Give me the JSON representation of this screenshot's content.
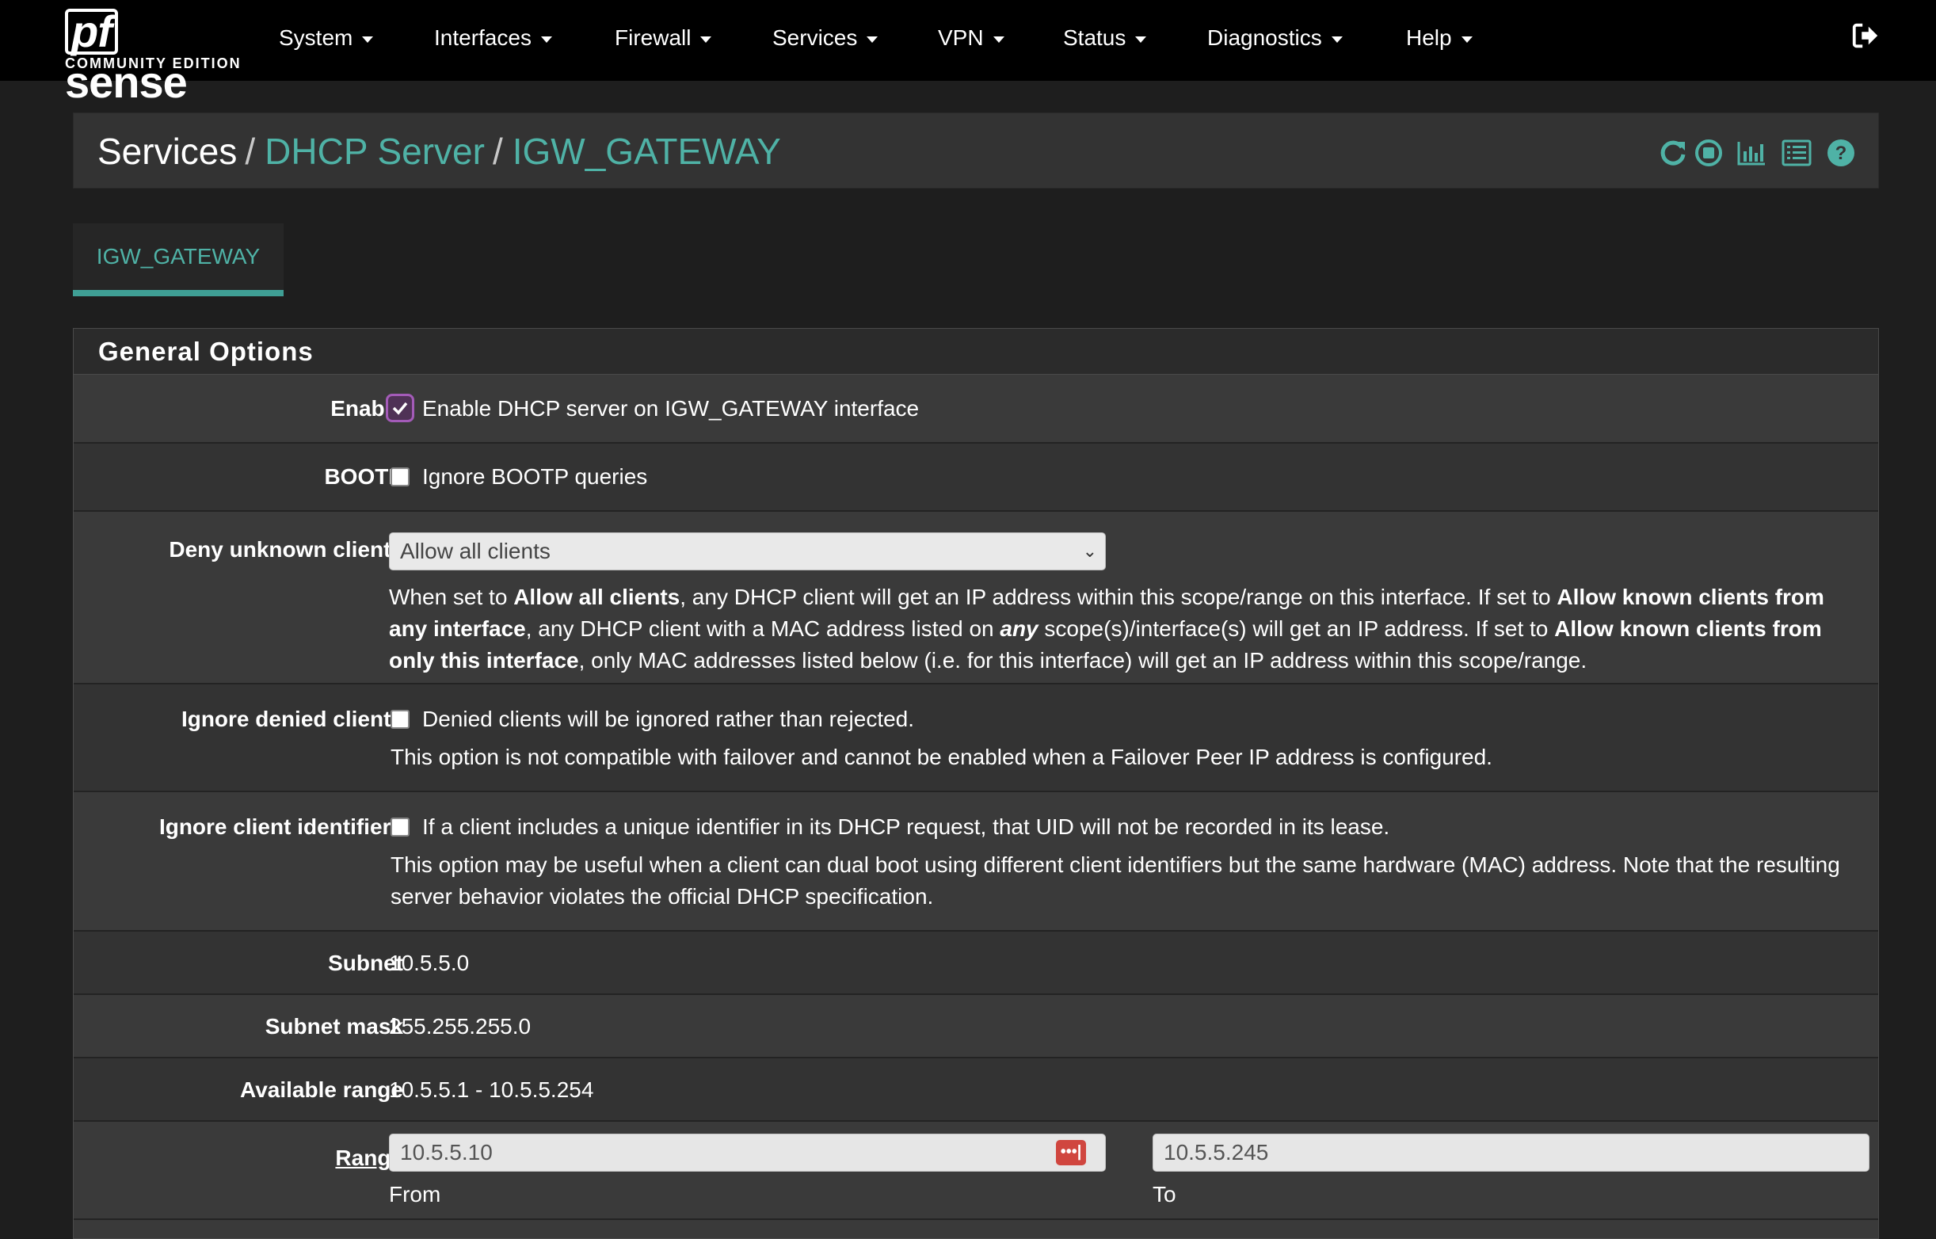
{
  "brand": {
    "logo_pf": "pf",
    "logo_sense": "sense",
    "edition": "COMMUNITY EDITION"
  },
  "nav": {
    "items": [
      "System",
      "Interfaces",
      "Firewall",
      "Services",
      "VPN",
      "Status",
      "Diagnostics",
      "Help"
    ]
  },
  "breadcrumb": {
    "root": "Services",
    "section": "DHCP Server",
    "page": "IGW_GATEWAY",
    "separator": "/"
  },
  "header_icons": [
    "restart-icon",
    "stop-icon",
    "chart-icon",
    "log-icon",
    "help-icon"
  ],
  "tabs": [
    {
      "label": "IGW_GATEWAY",
      "active": true
    }
  ],
  "general_options": {
    "heading": "General Options",
    "enable": {
      "label": "Enable",
      "text": "Enable DHCP server on IGW_GATEWAY interface",
      "checked": true
    },
    "bootp": {
      "label": "BOOTP",
      "text": "Ignore BOOTP queries",
      "checked": false
    },
    "deny_unknown": {
      "label": "Deny unknown clients",
      "selected": "Allow all clients",
      "help": {
        "p1": "When set to ",
        "b1": "Allow all clients",
        "p2": ", any DHCP client will get an IP address within this scope/range on this interface. If set to ",
        "b2": "Allow known clients from any interface",
        "p3": ", any DHCP client with a MAC address listed on ",
        "b3": "any",
        "p4": " scope(s)/interface(s) will get an IP address. If set to ",
        "b4": "Allow known clients from only this interface",
        "p5": ", only MAC addresses listed below (i.e. for this interface) will get an IP address within this scope/range."
      }
    },
    "ignore_denied": {
      "label": "Ignore denied clients",
      "text": "Denied clients will be ignored rather than rejected.",
      "help": "This option is not compatible with failover and cannot be enabled when a Failover Peer IP address is configured.",
      "checked": false
    },
    "ignore_client_ids": {
      "label": "Ignore client identifiers",
      "text": "If a client includes a unique identifier in its DHCP request, that UID will not be recorded in its lease.",
      "help": "This option may be useful when a client can dual boot using different client identifiers but the same hardware (MAC) address. Note that the resulting server behavior violates the official DHCP specification.",
      "checked": false
    },
    "subnet": {
      "label": "Subnet",
      "value": "10.5.5.0"
    },
    "subnet_mask": {
      "label": "Subnet mask",
      "value": "255.255.255.0"
    },
    "available_range": {
      "label": "Available range",
      "value": "10.5.5.1 - 10.5.5.254"
    },
    "range": {
      "label": "Range",
      "from_value": "10.5.5.10",
      "from_label": "From",
      "to_value": "10.5.5.245",
      "to_label": "To",
      "badge": "•••|"
    }
  },
  "colors": {
    "accent": "#4fb2a6",
    "navbar": "#000000",
    "panel": "#3a3a3a",
    "checkbox_checked": "#a35bb8",
    "badge": "#d0463f"
  }
}
